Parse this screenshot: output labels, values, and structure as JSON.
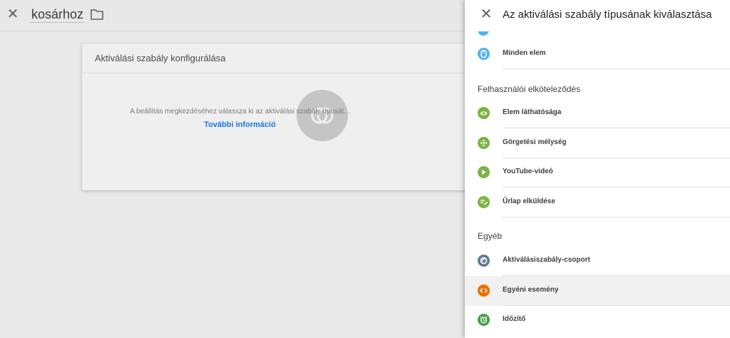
{
  "editor": {
    "name_value": "kosárhoz",
    "card_title": "Aktiválási szabály konfigurálása",
    "hint": "A beállítás megkezdéséhez válassza ki az aktiválási szabály típusát...",
    "more_info_link": "További információ"
  },
  "panel": {
    "title": "Az aktiválási szabály típusának kiválasztása",
    "top_items": [
      {
        "label": "Minden elem",
        "icon": "pointer-icon",
        "color": "#4fb3f2"
      }
    ],
    "sections": [
      {
        "heading": "Felhasználói elköteleződés",
        "items": [
          {
            "label": "Elem láthatósága",
            "icon": "eye-icon",
            "color": "#7cb342"
          },
          {
            "label": "Görgetési mélység",
            "icon": "move-arrows-icon",
            "color": "#7cb342"
          },
          {
            "label": "YouTube-videó",
            "icon": "play-icon",
            "color": "#7cb342"
          },
          {
            "label": "Űrlap elküldése",
            "icon": "form-check-icon",
            "color": "#7cb342"
          }
        ]
      },
      {
        "heading": "Egyéb",
        "items": [
          {
            "label": "Aktiválásiszabály-csoport",
            "icon": "trigger-group-icon",
            "color": "#607d8b"
          },
          {
            "label": "Egyéni esemény",
            "icon": "code-icon",
            "color": "#ef6c00",
            "selected": true
          },
          {
            "label": "Időzítő",
            "icon": "alarm-clock-icon",
            "color": "#43a047"
          }
        ]
      }
    ]
  }
}
